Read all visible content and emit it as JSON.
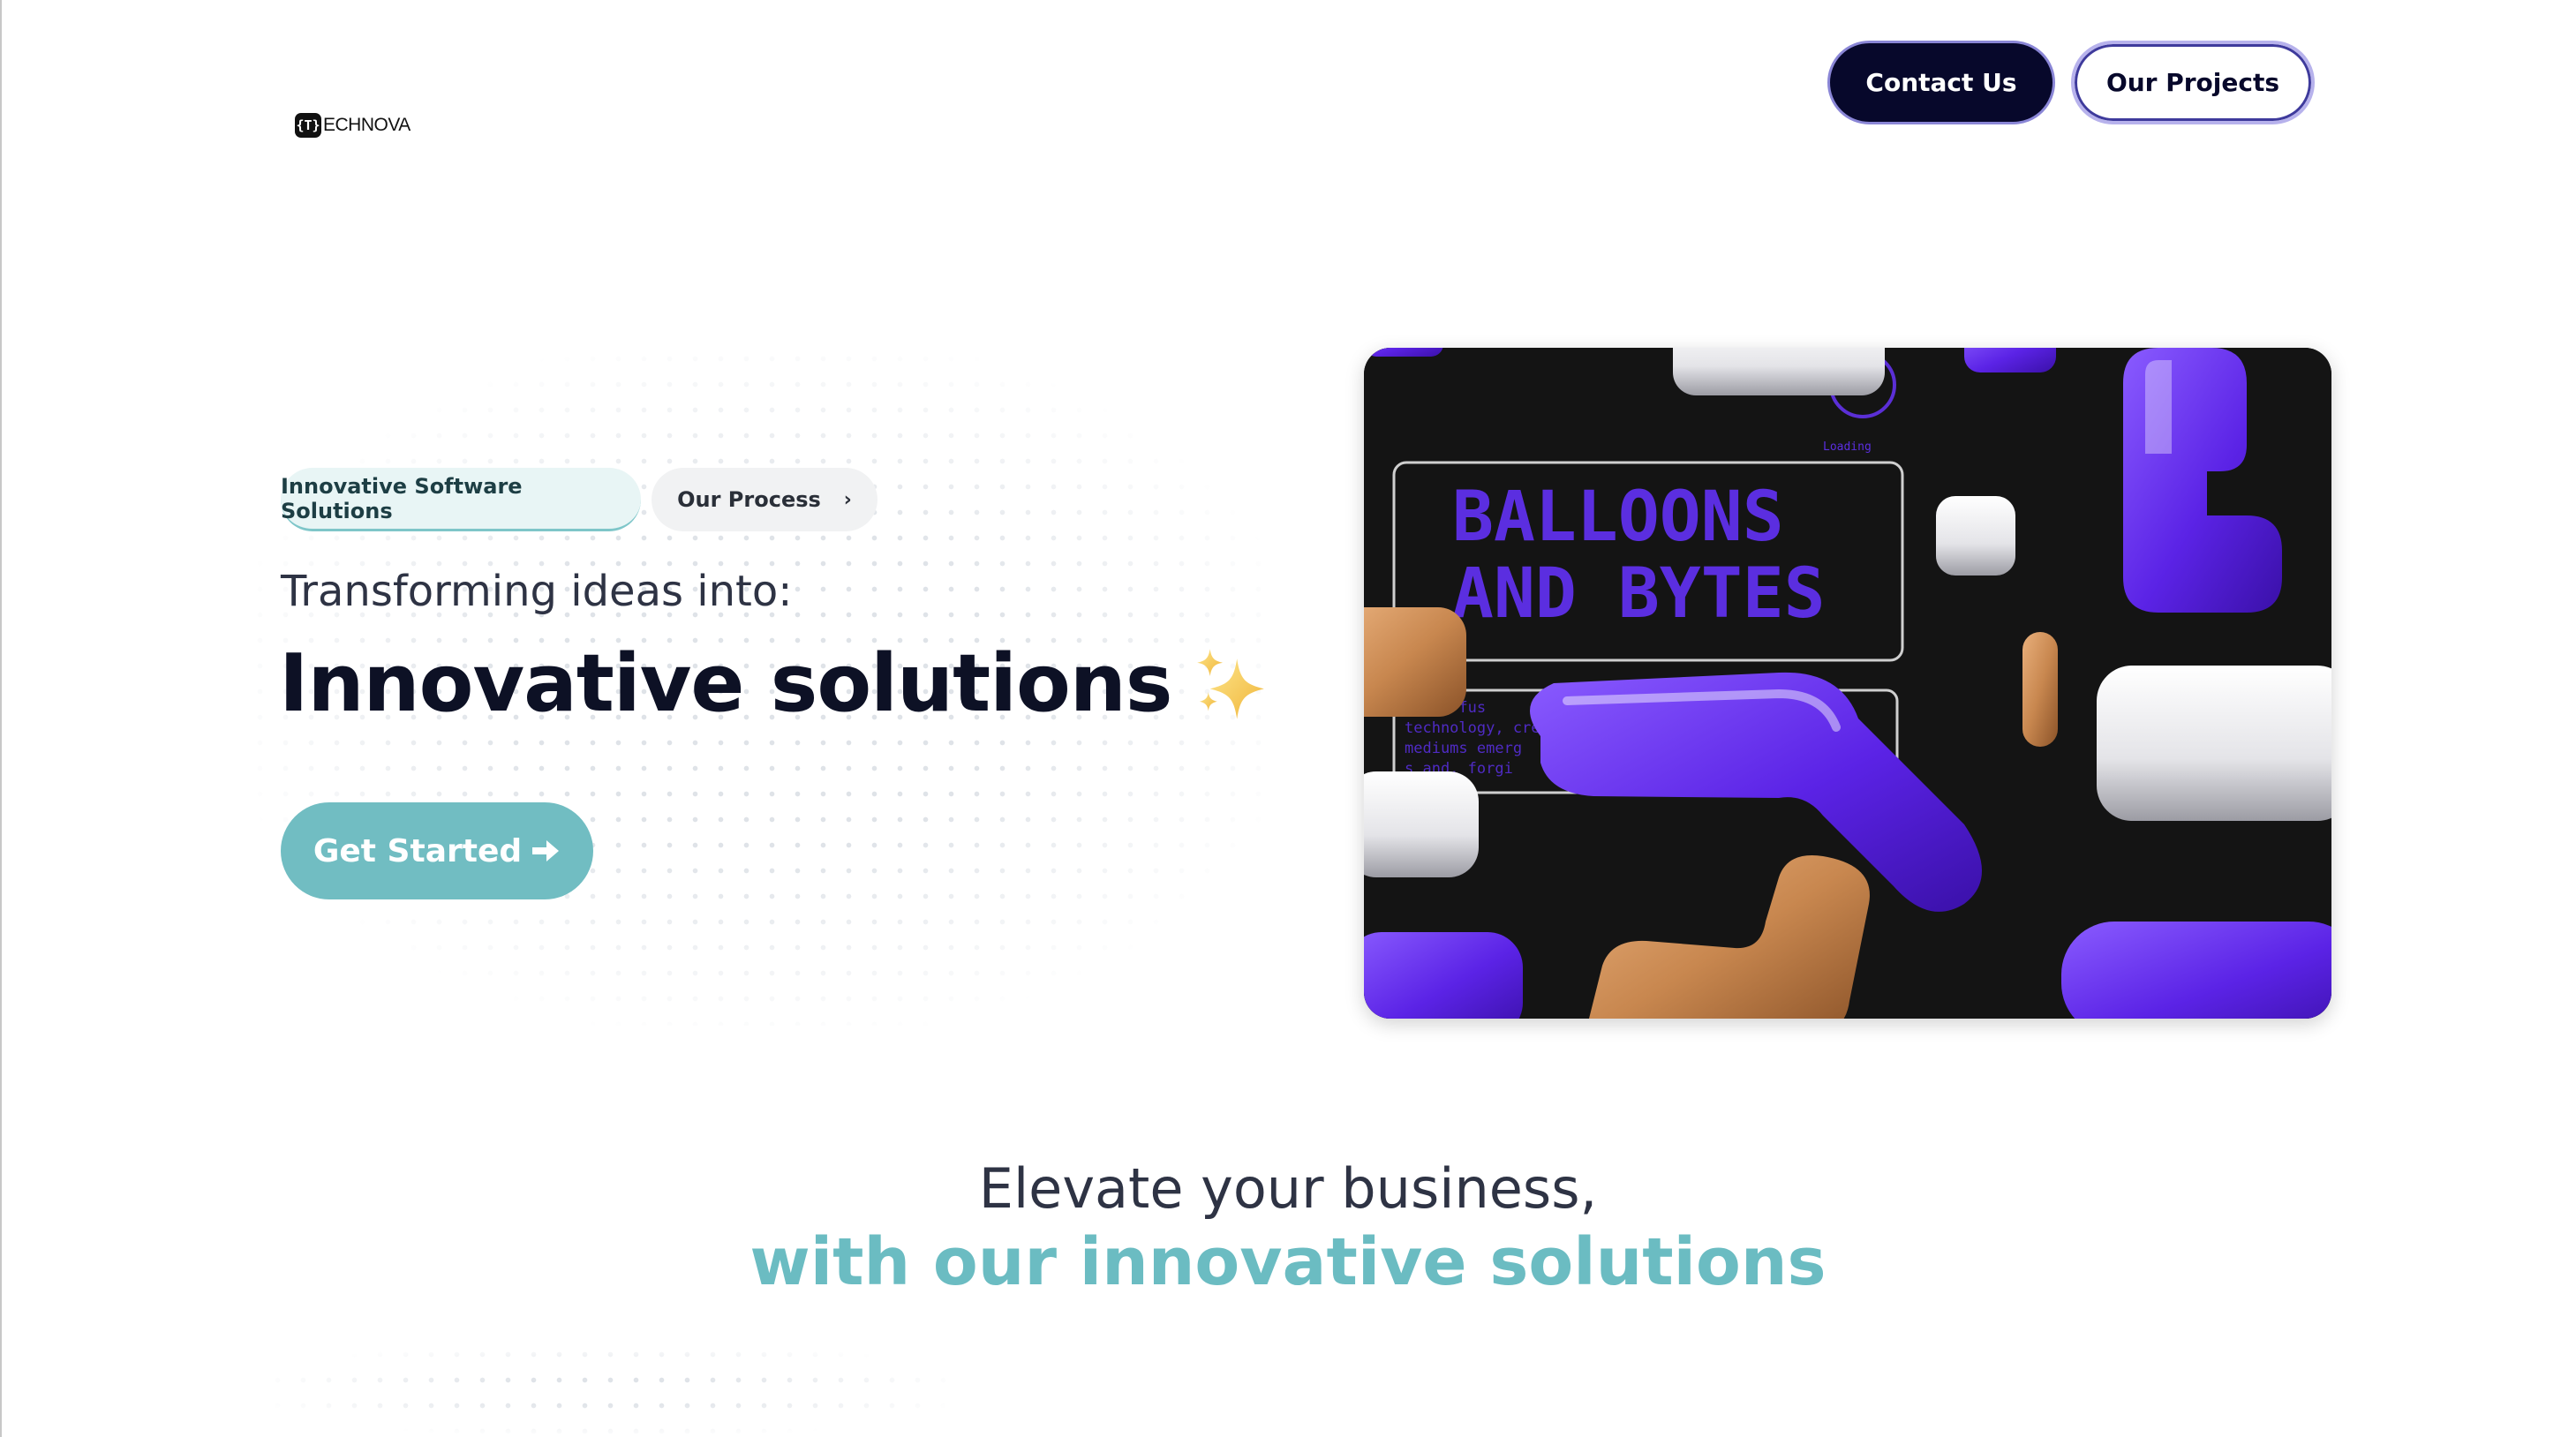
{
  "header": {
    "logo_mark": "{T}",
    "logo_text": "ECHNOVA",
    "contact_label": "Contact Us",
    "projects_label": "Our Projects"
  },
  "hero": {
    "pill_solutions": "Innovative Software Solutions",
    "pill_process": "Our Process",
    "subheading": "Transforming ideas into:",
    "headline": "Innovative solutions",
    "cta_label": "Get Started",
    "image_title_line1": "BALLOONS",
    "image_title_line2": "AND BYTES",
    "image_small_label": "Loading",
    "image_body_lines": [
      "g the fus",
      "technology, cre",
      "mediums emerg",
      "s and, forgi"
    ]
  },
  "section": {
    "line1": "Elevate your business,",
    "line2": "with our innovative solutions"
  },
  "colors": {
    "accent_teal": "#71bdc2",
    "navy": "#07082b",
    "purple": "#6b35f0",
    "balloon_orange": "#c98a52"
  },
  "icons": {
    "cta_arrow": "arrow-right-icon",
    "process_chevron": "chevron-right-icon",
    "sparkles": "sparkles-icon"
  }
}
